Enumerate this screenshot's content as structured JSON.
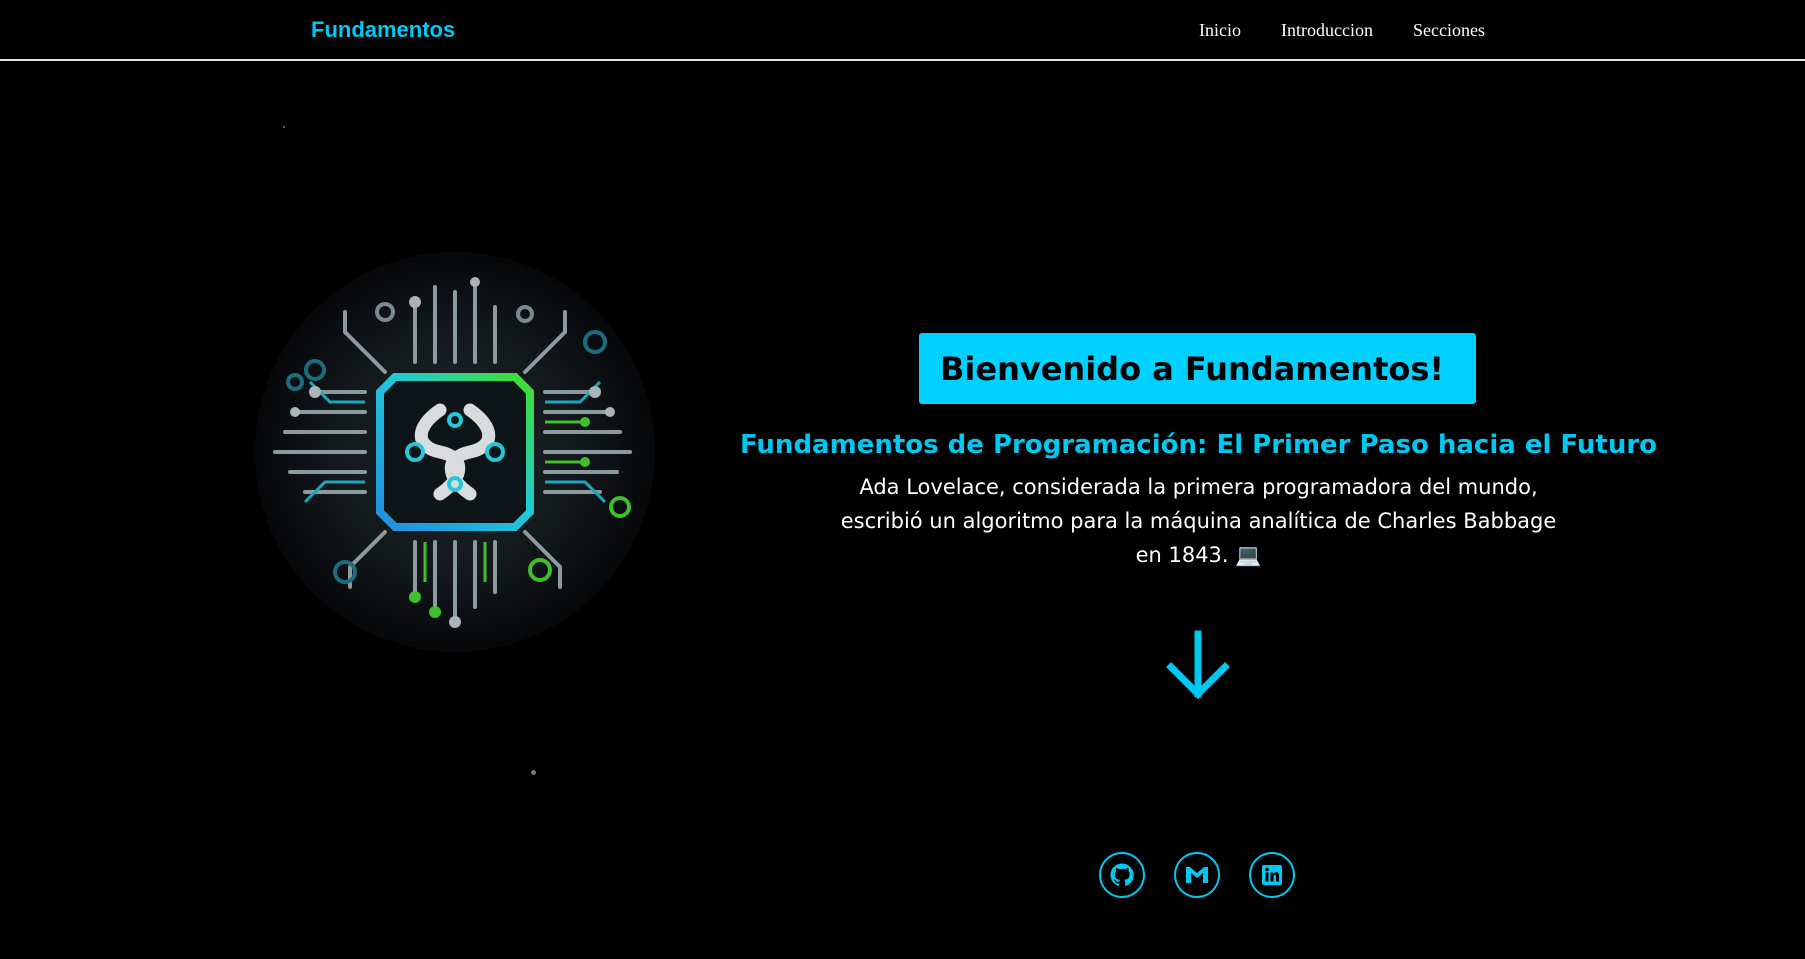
{
  "nav": {
    "brand": "Fundamentos",
    "links": [
      "Inicio",
      "Introduccion",
      "Secciones"
    ]
  },
  "hero": {
    "welcome": "Bienvenido a Fundamentos!",
    "subtitle": "Fundamentos de Programación: El Primer Paso hacia el Futuro",
    "description_lines": [
      "Ada Lovelace, considerada la primera programadora del mundo,",
      "escribió un algoritmo para la máquina analítica de Charles Babbage",
      "en 1843. 💻"
    ],
    "image_icon": "circuit-chip-logo-icon"
  },
  "socials": [
    {
      "icon": "github-icon"
    },
    {
      "icon": "gmail-icon"
    },
    {
      "icon": "linkedin-icon"
    }
  ],
  "colors": {
    "accent": "#00c8f0",
    "welcome_bg": "#00d1ff",
    "background": "#000000",
    "nav_border": "#e6e6e6"
  }
}
